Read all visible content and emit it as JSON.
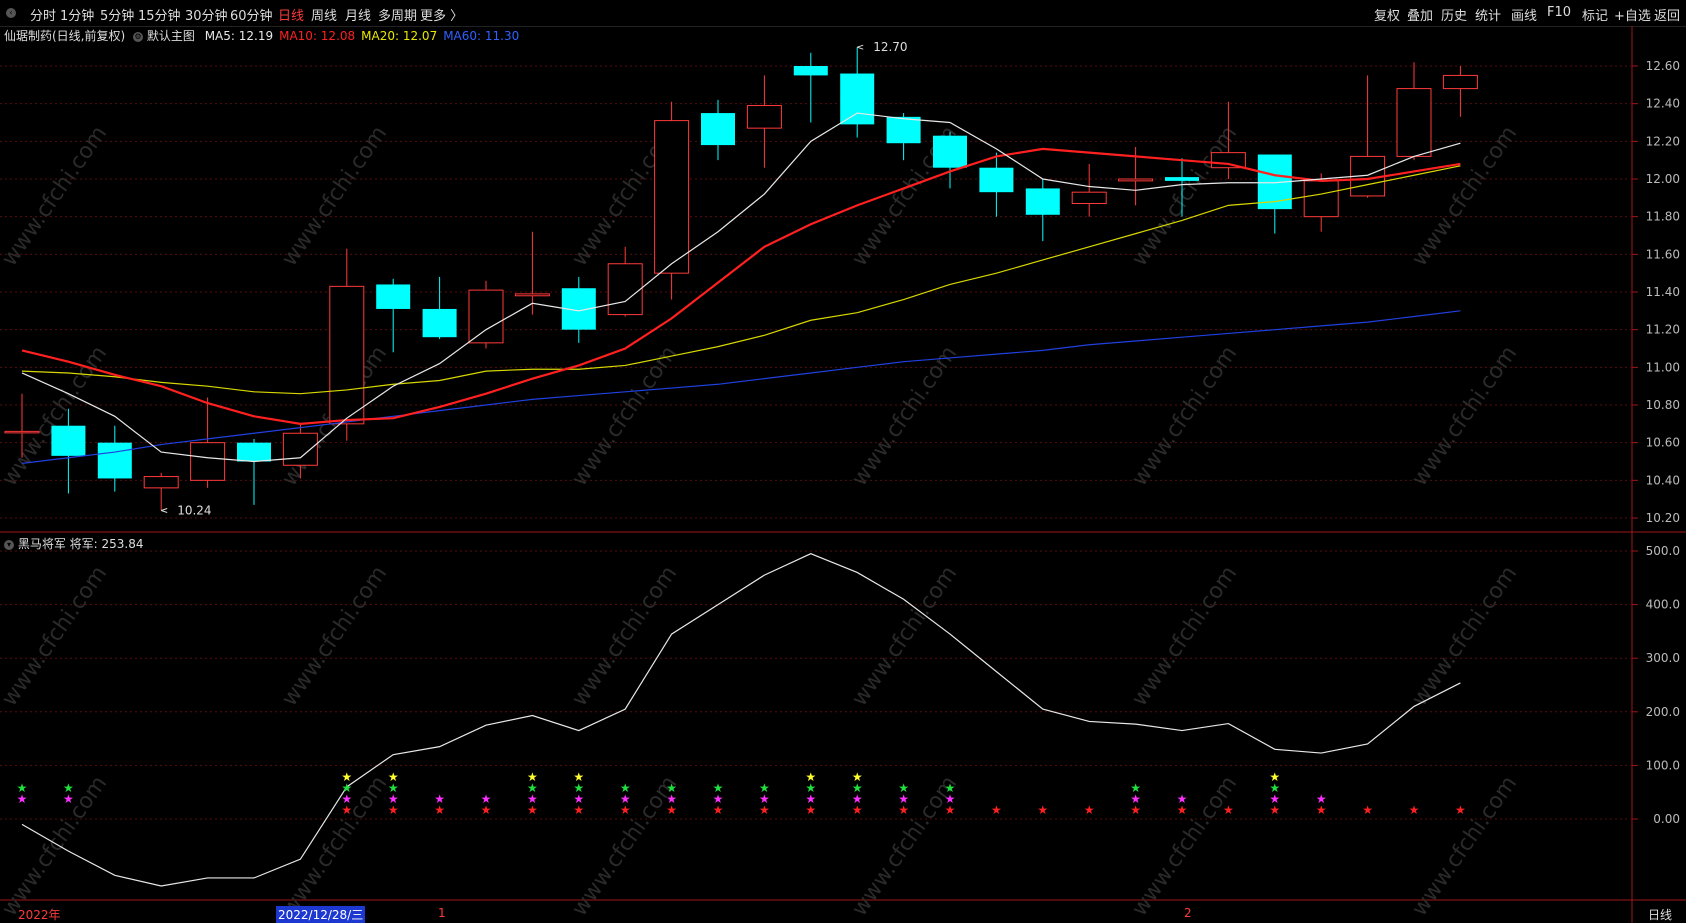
{
  "toolbar": {
    "periods": [
      "分时",
      "1分钟",
      "5分钟",
      "15分钟",
      "30分钟",
      "60分钟",
      "日线",
      "周线",
      "月线",
      "多周期",
      "更多 〉"
    ],
    "active_period": "日线",
    "right_items": [
      "复权",
      "叠加",
      "历史",
      "统计",
      "画线",
      "F10",
      "标记",
      "+自选",
      "返回"
    ]
  },
  "legend_main": {
    "stock": "仙琚制药(日线,前复权)",
    "main_label": "默认主图",
    "ma": [
      {
        "label": "MA5: 12.19",
        "color": "#e8e8e8"
      },
      {
        "label": "MA10: 12.08",
        "color": "#ff2020"
      },
      {
        "label": "MA20: 12.07",
        "color": "#e8e800"
      },
      {
        "label": "MA60: 11.30",
        "color": "#3060ff"
      }
    ]
  },
  "legend_sub": {
    "title": "黑马将军",
    "value": "将军: 253.84"
  },
  "annotations": {
    "high": "12.70",
    "low": "10.24"
  },
  "bottom": {
    "year": "2022年",
    "cursor_date": "2022/12/28/三",
    "m1": "1",
    "m2": "2",
    "period": "日线"
  },
  "watermark": "www.cfchi.com",
  "chart_data": [
    {
      "type": "candlestick",
      "yticks": [
        "12.60",
        "12.40",
        "12.20",
        "12.00",
        "11.80",
        "11.60",
        "11.40",
        "11.20",
        "11.00",
        "10.80",
        "10.60",
        "10.40",
        "10.20"
      ],
      "ylim": [
        10.12,
        12.82
      ],
      "candles": [
        {
          "o": 10.66,
          "h": 10.86,
          "l": 10.52,
          "c": 10.66
        },
        {
          "o": 10.69,
          "h": 10.78,
          "l": 10.33,
          "c": 10.53
        },
        {
          "o": 10.6,
          "h": 10.69,
          "l": 10.34,
          "c": 10.41
        },
        {
          "o": 10.36,
          "h": 10.44,
          "l": 10.24,
          "c": 10.42
        },
        {
          "o": 10.4,
          "h": 10.84,
          "l": 10.36,
          "c": 10.6
        },
        {
          "o": 10.6,
          "h": 10.62,
          "l": 10.27,
          "c": 10.5
        },
        {
          "o": 10.48,
          "h": 10.7,
          "l": 10.41,
          "c": 10.65
        },
        {
          "o": 10.7,
          "h": 11.63,
          "l": 10.61,
          "c": 11.43
        },
        {
          "o": 11.44,
          "h": 11.47,
          "l": 11.08,
          "c": 11.31
        },
        {
          "o": 11.31,
          "h": 11.48,
          "l": 11.15,
          "c": 11.16
        },
        {
          "o": 11.13,
          "h": 11.46,
          "l": 11.1,
          "c": 11.41
        },
        {
          "o": 11.38,
          "h": 11.72,
          "l": 11.28,
          "c": 11.39
        },
        {
          "o": 11.42,
          "h": 11.48,
          "l": 11.13,
          "c": 11.2
        },
        {
          "o": 11.28,
          "h": 11.64,
          "l": 11.27,
          "c": 11.55
        },
        {
          "o": 11.5,
          "h": 12.41,
          "l": 11.36,
          "c": 12.31
        },
        {
          "o": 12.35,
          "h": 12.42,
          "l": 12.1,
          "c": 12.18
        },
        {
          "o": 12.27,
          "h": 12.55,
          "l": 12.06,
          "c": 12.39
        },
        {
          "o": 12.6,
          "h": 12.67,
          "l": 12.3,
          "c": 12.55
        },
        {
          "o": 12.56,
          "h": 12.7,
          "l": 12.22,
          "c": 12.29
        },
        {
          "o": 12.33,
          "h": 12.35,
          "l": 12.1,
          "c": 12.19
        },
        {
          "o": 12.23,
          "h": 12.25,
          "l": 11.95,
          "c": 12.06
        },
        {
          "o": 12.06,
          "h": 12.14,
          "l": 11.8,
          "c": 11.93
        },
        {
          "o": 11.95,
          "h": 12.0,
          "l": 11.67,
          "c": 11.81
        },
        {
          "o": 11.87,
          "h": 12.08,
          "l": 11.8,
          "c": 11.93
        },
        {
          "o": 11.99,
          "h": 12.17,
          "l": 11.86,
          "c": 12.0
        },
        {
          "o": 12.01,
          "h": 12.11,
          "l": 11.8,
          "c": 11.99
        },
        {
          "o": 12.06,
          "h": 12.41,
          "l": 12.0,
          "c": 12.14
        },
        {
          "o": 12.13,
          "h": 12.13,
          "l": 11.71,
          "c": 11.84
        },
        {
          "o": 11.8,
          "h": 12.03,
          "l": 11.72,
          "c": 11.99
        },
        {
          "o": 11.91,
          "h": 12.55,
          "l": 11.9,
          "c": 12.12
        },
        {
          "o": 12.12,
          "h": 12.62,
          "l": 12.1,
          "c": 12.48
        },
        {
          "o": 12.48,
          "h": 12.6,
          "l": 12.33,
          "c": 12.55
        }
      ],
      "ma5": [
        10.97,
        10.86,
        10.74,
        10.55,
        10.52,
        10.5,
        10.52,
        10.73,
        10.9,
        11.02,
        11.2,
        11.34,
        11.3,
        11.35,
        11.55,
        11.72,
        11.92,
        12.2,
        12.35,
        12.32,
        12.3,
        12.16,
        12.0,
        11.96,
        11.94,
        11.97,
        11.98,
        11.98,
        12.0,
        12.02,
        12.12,
        12.19
      ],
      "ma10": [
        11.09,
        11.03,
        10.96,
        10.9,
        10.81,
        10.74,
        10.7,
        10.72,
        10.73,
        10.79,
        10.86,
        10.94,
        11.01,
        11.1,
        11.26,
        11.45,
        11.64,
        11.76,
        11.86,
        11.95,
        12.04,
        12.12,
        12.16,
        12.14,
        12.12,
        12.1,
        12.08,
        12.02,
        11.99,
        12.0,
        12.04,
        12.08
      ],
      "ma20": [
        10.98,
        10.97,
        10.95,
        10.92,
        10.9,
        10.87,
        10.86,
        10.88,
        10.91,
        10.93,
        10.98,
        10.99,
        10.99,
        11.01,
        11.06,
        11.11,
        11.17,
        11.25,
        11.29,
        11.36,
        11.44,
        11.5,
        11.57,
        11.64,
        11.71,
        11.78,
        11.86,
        11.88,
        11.92,
        11.97,
        12.02,
        12.07
      ],
      "ma60": [
        10.49,
        10.52,
        10.55,
        10.59,
        10.62,
        10.65,
        10.68,
        10.71,
        10.74,
        10.77,
        10.8,
        10.83,
        10.85,
        10.87,
        10.89,
        10.91,
        10.94,
        10.97,
        11.0,
        11.03,
        11.05,
        11.07,
        11.09,
        11.12,
        11.14,
        11.16,
        11.18,
        11.2,
        11.22,
        11.24,
        11.27,
        11.3
      ]
    },
    {
      "type": "line",
      "title": "黑马将军",
      "yticks": [
        "500.0",
        "400.0",
        "300.0",
        "200.0",
        "100.0",
        "0.00"
      ],
      "ylim": [
        -160,
        520
      ],
      "values": [
        -10,
        -60,
        -105,
        -125,
        -110,
        -110,
        -75,
        60,
        120,
        135,
        175,
        193,
        165,
        205,
        345,
        400,
        455,
        495,
        460,
        410,
        345,
        275,
        205,
        182,
        177,
        165,
        178,
        130,
        123,
        140,
        210,
        253.84
      ],
      "stars": {
        "yellow": [
          7,
          8,
          11,
          12,
          17,
          18,
          27
        ],
        "green": [
          0,
          1,
          7,
          8,
          11,
          12,
          13,
          14,
          15,
          16,
          17,
          18,
          19,
          20,
          24,
          27
        ],
        "magenta": [
          0,
          1,
          7,
          8,
          9,
          10,
          11,
          12,
          13,
          14,
          15,
          16,
          17,
          18,
          19,
          20,
          24,
          25,
          27,
          28
        ],
        "red": [
          7,
          8,
          9,
          10,
          11,
          12,
          13,
          14,
          15,
          16,
          17,
          18,
          19,
          20,
          21,
          22,
          23,
          24,
          25,
          26,
          27,
          28,
          29,
          30,
          31
        ]
      }
    }
  ]
}
